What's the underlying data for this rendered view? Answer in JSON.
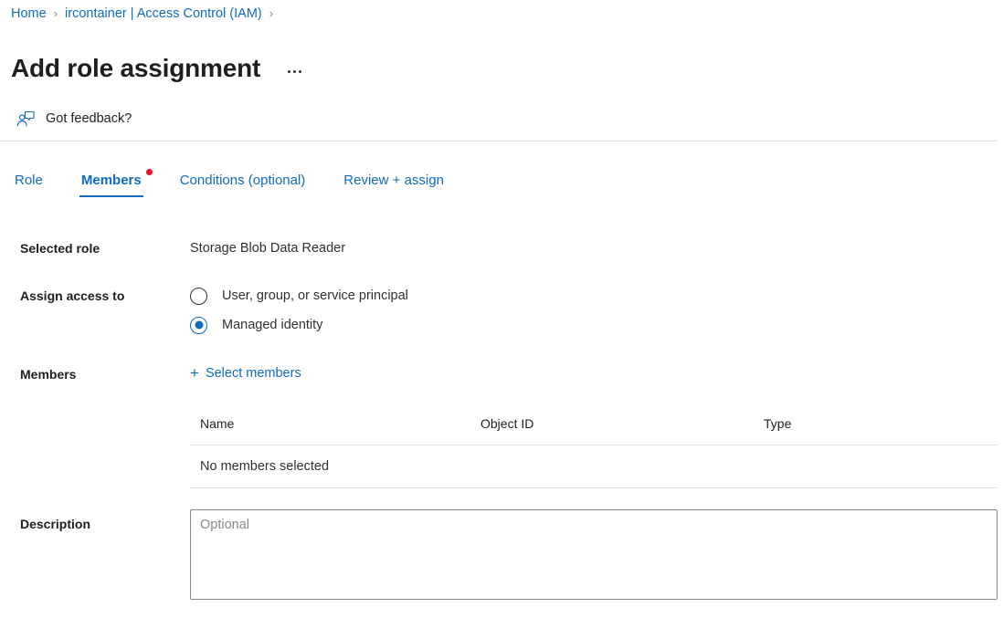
{
  "breadcrumb": {
    "items": [
      {
        "label": "Home"
      },
      {
        "label": "ircontainer | Access Control (IAM)"
      }
    ],
    "separator": "›",
    "trailing_separator": "›"
  },
  "header": {
    "title": "Add role assignment",
    "more_menu_name": "more-commands"
  },
  "command_bar": {
    "feedback_label": "Got feedback?",
    "feedback_icon": "feedback-person-icon"
  },
  "tabs": [
    {
      "label": "Role",
      "active": false,
      "badge": false
    },
    {
      "label": "Members",
      "active": true,
      "badge": true
    },
    {
      "label": "Conditions (optional)",
      "active": false,
      "badge": false
    },
    {
      "label": "Review + assign",
      "active": false,
      "badge": false
    }
  ],
  "form": {
    "selected_role": {
      "label": "Selected role",
      "value": "Storage Blob Data Reader"
    },
    "assign_access_to": {
      "label": "Assign access to",
      "options": [
        {
          "label": "User, group, or service principal",
          "selected": false
        },
        {
          "label": "Managed identity",
          "selected": true
        }
      ]
    },
    "members": {
      "label": "Members",
      "select_action": "Select members",
      "plus_icon": "plus-icon",
      "table": {
        "columns": [
          "Name",
          "Object ID",
          "Type"
        ],
        "rows": [],
        "empty_message": "No members selected"
      }
    },
    "description": {
      "label": "Description",
      "value": "",
      "placeholder": "Optional"
    }
  },
  "colors": {
    "accent": "#0f6cbd",
    "badge": "#e81123",
    "text": "#323130",
    "heading": "#201f1e",
    "border": "#e1dfdd",
    "input_border": "#8a8886"
  }
}
